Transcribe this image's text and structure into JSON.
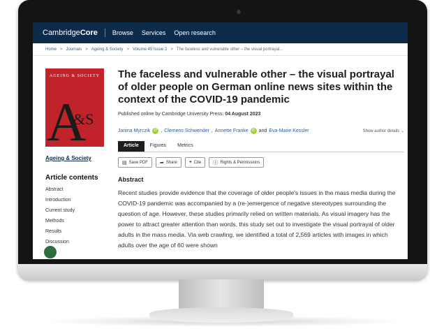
{
  "header": {
    "brand_light": "Cambridge",
    "brand_bold": "Core",
    "nav": [
      "Browse",
      "Services",
      "Open research"
    ]
  },
  "breadcrumb": [
    "Home",
    "Journals",
    "Ageing & Society",
    "Volume 45 Issue 2",
    "The faceless and vulnerable other – the visual portrayal..."
  ],
  "sidebar": {
    "cover_title": "AGEING & SOCIETY",
    "cover_letter_a": "A",
    "cover_letter_amp": "&S",
    "journal_name": "Ageing & Society",
    "contents_heading": "Article contents",
    "contents": [
      "Abstract",
      "Introduction",
      "Current study",
      "Methods",
      "Results",
      "Discussion"
    ]
  },
  "article": {
    "title": "The faceless and vulnerable other – the visual portrayal of older people on German online news sites within the context of the COVID-19 pandemic",
    "published_prefix": "Published online by Cambridge University Press:",
    "published_date": "04 August 2023",
    "authors": [
      "Janina Myrczik",
      "Clemens Schwender",
      "Annette Franke",
      "Eva-Marie Kessler"
    ],
    "and": "and",
    "show_author_details": "Show author details",
    "tabs": [
      "Article",
      "Figures",
      "Metrics"
    ],
    "tools": [
      {
        "icon": "pdf-icon",
        "label": "Save PDF"
      },
      {
        "icon": "share-icon",
        "label": "Share"
      },
      {
        "icon": "quote-icon",
        "label": "Cite"
      },
      {
        "icon": "permissions-icon",
        "label": "Rights & Permissions"
      }
    ],
    "abstract_heading": "Abstract",
    "abstract_text": "Recent studies provide evidence that the coverage of older people's issues in the mass media during the COVID-19 pandemic was accompanied by a (re-)emergence of negative stereotypes surrounding the question of age. However, these studies primarily relied on written materials. As visual imagery has the power to attract greater attention than words, this study set out to investigate the visual portrayal of older adults in the mass media. Via web crawling, we identified a total of 2,569 articles with images in which adults over the age of 60 were shown"
  },
  "colors": {
    "topbar": "#0c2b4b",
    "link": "#2f5f9a",
    "cover": "#c0232a",
    "orcid": "#a6ce39"
  }
}
